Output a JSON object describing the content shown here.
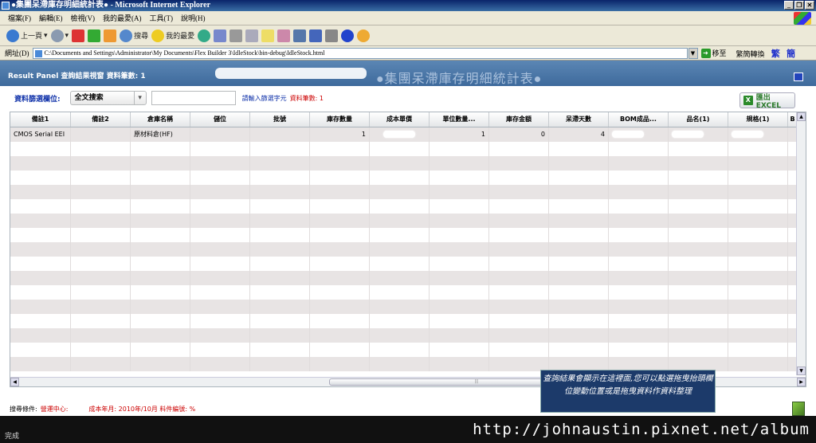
{
  "window": {
    "title": "●集團呆滯庫存明細統計表● - Microsoft Internet Explorer"
  },
  "menu": [
    "檔案(F)",
    "編輯(E)",
    "檢視(V)",
    "我的最愛(A)",
    "工具(T)",
    "說明(H)"
  ],
  "toolbar": {
    "back": "上一頁",
    "search": "搜尋",
    "favorites": "我的最愛"
  },
  "address": {
    "label": "網址(D)",
    "url": "C:\\Documents and Settings\\Administrator\\My Documents\\Flex Builder 3\\IdleStock\\bin-debug\\IdleStock.html",
    "go": "移至",
    "convert": "繁簡轉換",
    "trad": "繁",
    "simp": "簡"
  },
  "panel": {
    "header": "Result Panel 查詢結果視窗  資料筆數: 1",
    "big_title": "●集團呆滯庫存明細統計表●"
  },
  "filter": {
    "label": "資料篩選欄位:",
    "combo_value": "全文搜索",
    "hint": "請輸入篩選字元",
    "count": "資料筆數: 1",
    "export": "匯出EXCEL"
  },
  "grid": {
    "columns": [
      "備註1",
      "備註2",
      "倉庫名稱",
      "儲位",
      "批號",
      "庫存數量",
      "成本單價",
      "單位數量...",
      "庫存金額",
      "呆滯天數",
      "BOM成品...",
      "品名(1)",
      "規格(1)",
      "B"
    ],
    "row": {
      "c0": "CMOS Serial EEI",
      "c2": "原材料倉(HF)",
      "c5": "1",
      "c7": "1",
      "c8": "0",
      "c9": "4"
    }
  },
  "footer": {
    "cond_label": "搜尋條件:",
    "cond_value": "營運中心:",
    "period": "成本年月: 2010年/10月 料件編號: %"
  },
  "tooltip": {
    "text": "查詢結果會顯示在這裡面,您可以點選拖曳抬頭欄位變動位置或是拖曳資料作資料整理"
  },
  "status": {
    "text": "完成",
    "watermark": "http://johnaustin.pixnet.net/album"
  }
}
